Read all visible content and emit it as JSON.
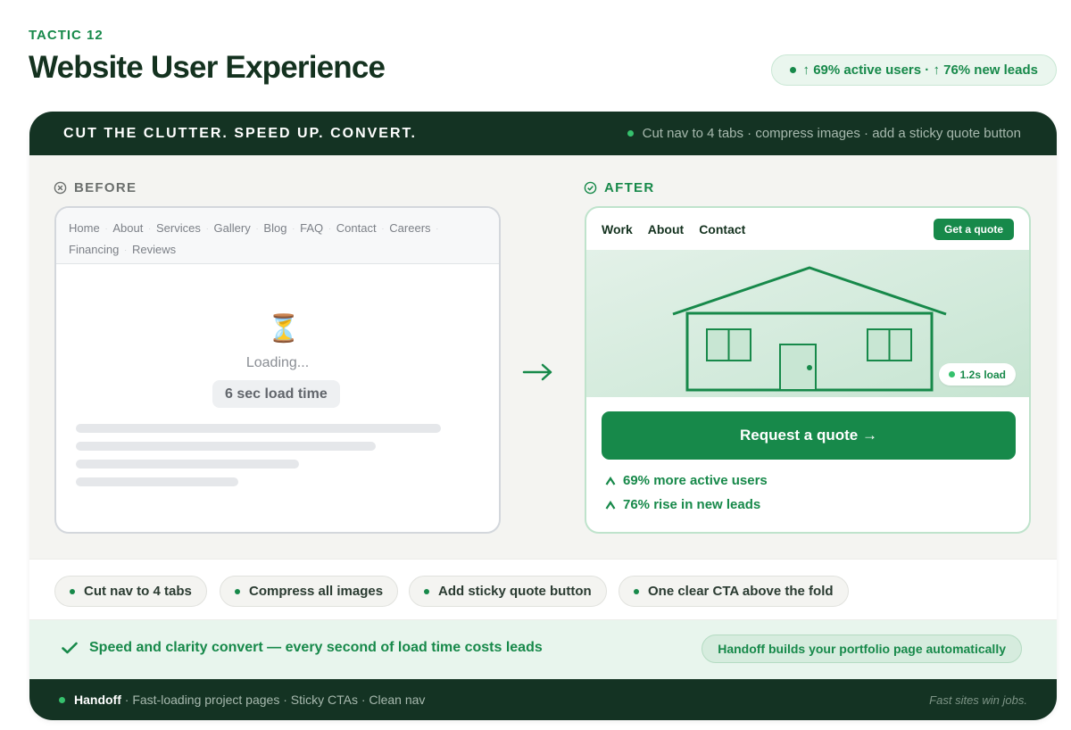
{
  "header": {
    "eyebrow": "TACTIC 12",
    "title": "Website User Experience",
    "stat_pill": "↑ 69% active users · ↑ 76% new leads"
  },
  "card": {
    "heading": "CUT THE CLUTTER. SPEED UP. CONVERT.",
    "note": "Cut nav to 4 tabs · compress images · add a sticky quote button"
  },
  "before": {
    "label": "BEFORE",
    "nav_items": [
      "Home",
      "About",
      "Services",
      "Gallery",
      "Blog",
      "FAQ",
      "Contact",
      "Careers",
      "Financing",
      "Reviews"
    ],
    "loading_text": "Loading...",
    "load_time": "6 sec load time"
  },
  "after": {
    "label": "AFTER",
    "nav_items": [
      "Work",
      "About",
      "Contact"
    ],
    "quote_button": "Get a quote",
    "load_chip": "1.2s load",
    "cta": "Request a quote →",
    "metrics": [
      "69% more active users",
      "76% rise in new leads"
    ]
  },
  "chips": [
    "Cut nav to 4 tabs",
    "Compress all images",
    "Add sticky quote button",
    "One clear CTA above the fold"
  ],
  "banner": {
    "message": "Speed and clarity convert — every second of load time costs leads",
    "handoff": "Handoff builds your portfolio page automatically"
  },
  "footer": {
    "brand": "Handoff",
    "features": "· Fast-loading project pages · Sticky CTAs · Clean nav",
    "tagline": "Fast sites win jobs."
  },
  "colors": {
    "brand_green": "#17894a",
    "dark_green": "#143323",
    "light_green": "#e8f5ed"
  }
}
